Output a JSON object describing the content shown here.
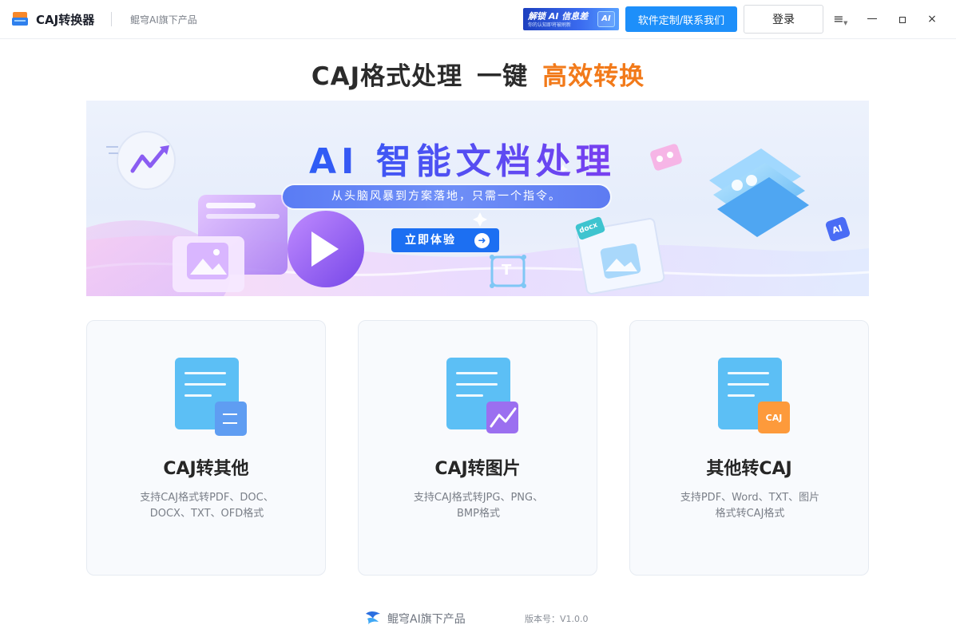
{
  "titlebar": {
    "app_name": "CAJ转换器",
    "subtitle": "鲲穹AI旗下产品",
    "promo": {
      "line1": "解锁 AI 信息差",
      "line2": "你的认知即将被刷新",
      "chip": "AI"
    },
    "contact_label": "软件定制/联系我们",
    "login_label": "登录",
    "menu_icon": "≡",
    "close_icon": "×"
  },
  "headline": {
    "part1": "CAJ格式处理",
    "part2": "一键",
    "part3": "高效转换",
    "accent_color": "#f27a1a"
  },
  "banner": {
    "title": "AI 智能文档处理",
    "subtitle": "从头脑风暴到方案落地，只需一个指令。",
    "cta_label": "立即体验",
    "cta_arrow": "➜",
    "deco_labels": {
      "docx": "docx",
      "ai": "AI",
      "text": "T"
    }
  },
  "cards": [
    {
      "title": "CAJ转其他",
      "desc_line1": "支持CAJ格式转PDF、DOC、",
      "desc_line2": "DOCX、TXT、OFD格式",
      "badge": ""
    },
    {
      "title": "CAJ转图片",
      "desc_line1": "支持CAJ格式转JPG、PNG、",
      "desc_line2": "BMP格式",
      "badge": ""
    },
    {
      "title": "其他转CAJ",
      "desc_line1": "支持PDF、Word、TXT、图片",
      "desc_line2": "格式转CAJ格式",
      "badge": "CAJ"
    }
  ],
  "footer": {
    "brand": "鲲穹AI旗下产品",
    "version": "版本号：V1.0.0"
  },
  "colors": {
    "primary_blue": "#1d8ffa",
    "accent_orange": "#f27a1a",
    "doc_icon_blue": "#5cbff5",
    "badge_blue": "#5f9df2",
    "badge_purple": "#9b6ff0",
    "badge_orange": "#fd9a3b"
  }
}
